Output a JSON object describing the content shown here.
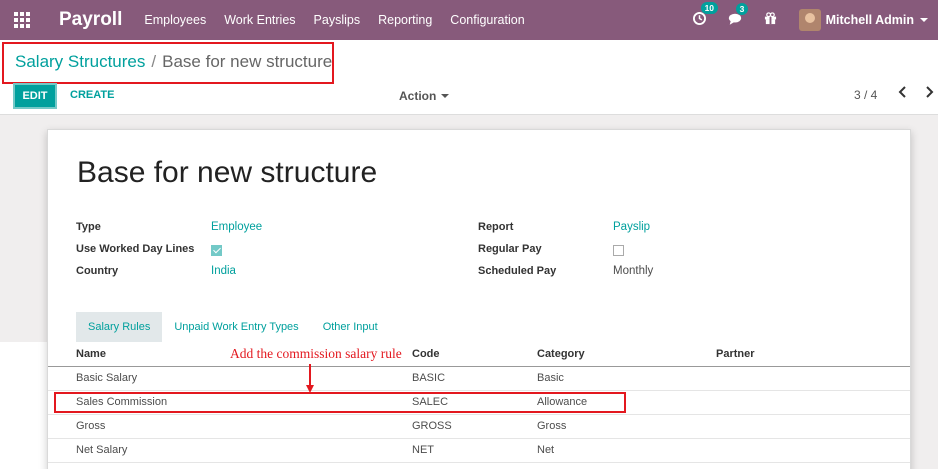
{
  "navbar": {
    "brand": "Payroll",
    "menu": [
      "Employees",
      "Work Entries",
      "Payslips",
      "Reporting",
      "Configuration"
    ],
    "activity_count": "10",
    "message_count": "3",
    "user_name": "Mitchell Admin"
  },
  "breadcrumb": {
    "parent": "Salary Structures",
    "separator": "/",
    "current": "Base for new structure"
  },
  "controls": {
    "edit_label": "EDIT",
    "create_label": "CREATE",
    "action_label": "Action",
    "pager": "3 / 4"
  },
  "form": {
    "title": "Base for new structure",
    "fields_left": [
      {
        "label": "Type",
        "value": "Employee"
      },
      {
        "label": "Use Worked Day Lines",
        "checked": true
      },
      {
        "label": "Country",
        "value": "India"
      }
    ],
    "fields_right": [
      {
        "label": "Report",
        "value": "Payslip"
      },
      {
        "label": "Regular Pay",
        "checked": false
      },
      {
        "label": "Scheduled Pay",
        "value": "Monthly"
      }
    ]
  },
  "tabs": [
    "Salary Rules",
    "Unpaid Work Entry Types",
    "Other Input"
  ],
  "table": {
    "headers": [
      "Name",
      "Code",
      "Category",
      "Partner"
    ],
    "rows": [
      {
        "name": "Basic Salary",
        "code": "BASIC",
        "category": "Basic"
      },
      {
        "name": "Sales Commission",
        "code": "SALEC",
        "category": "Allowance"
      },
      {
        "name": "Gross",
        "code": "GROSS",
        "category": "Gross"
      },
      {
        "name": "Net Salary",
        "code": "NET",
        "category": "Net"
      }
    ]
  },
  "annotation": "Add the commission salary rule",
  "colors": {
    "navbar": "#875a7b",
    "accent": "#00a09d",
    "highlight": "#e3181f"
  }
}
